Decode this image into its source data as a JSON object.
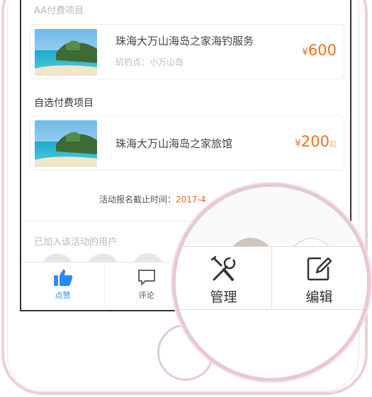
{
  "paid_section": {
    "label": "AA付费项目"
  },
  "paid_item": {
    "title": "珠海大万山海岛之家海钓服务",
    "subtitle": "矶钓点：小万山岛",
    "price_symbol": "¥",
    "price": "600"
  },
  "optional_section": {
    "label": "自选付费项目"
  },
  "optional_item": {
    "title": "珠海大万山海岛之家旅馆",
    "price_symbol": "¥",
    "price": "200",
    "price_suffix": "起"
  },
  "deadline": {
    "label": "活动报名截止时间：",
    "date": "2017-4"
  },
  "joined_section": {
    "label": "已加入该活动的用户"
  },
  "tabbar": {
    "like": {
      "label": "点赞",
      "icon": "thumbs-up-icon"
    },
    "comment": {
      "label": "评论",
      "icon": "comment-icon"
    }
  },
  "magnifier": {
    "manage": {
      "label": "管理",
      "icon": "tools-icon"
    },
    "edit": {
      "label": "编辑",
      "icon": "edit-icon"
    }
  },
  "colors": {
    "accent_blue": "#2a8bf2",
    "price_orange": "#f36d21",
    "frame_pink": "#e8c8d6"
  }
}
